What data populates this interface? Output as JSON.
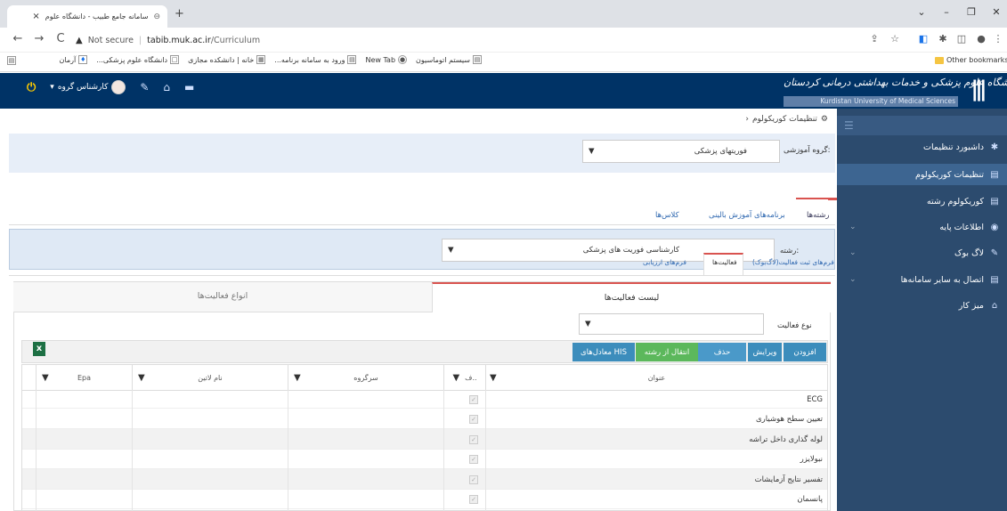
{
  "browser": {
    "tab_title": "سامانه جامع طبیب - دانشگاه علوم",
    "tab_close": "×",
    "new_tab": "+",
    "not_secure": "Not secure",
    "url_host": "tabib.muk.ac.ir",
    "url_path": "/Curriculum",
    "bookmarks": [
      {
        "label": "سیستم اتوماسیون"
      },
      {
        "label": "New Tab"
      },
      {
        "label": "ورود به سامانه برنامه..."
      },
      {
        "label": "خانه | دانشکده مجازی"
      },
      {
        "label": "دانشگاه علوم پزشکی..."
      },
      {
        "label": "آرمان"
      }
    ],
    "other_bookmarks": "Other bookmarks"
  },
  "header": {
    "uni_name_fa": "دانشگاه علوم پزشکی و خدمات بهداشتی درمانی کردستان",
    "uni_name_en": "Kurdistan University of Medical Sciences",
    "user_label": "کارشناس گروه"
  },
  "breadcrumb": {
    "label": "تنظیمات کوریکولوم"
  },
  "sidebar": {
    "items": [
      {
        "label": "داشبورد تنظیمات"
      },
      {
        "label": "تنظیمات کوریکولوم"
      },
      {
        "label": "کوریکولوم رشته"
      },
      {
        "label": "اطلاعات پایه"
      },
      {
        "label": "لاگ بوک"
      },
      {
        "label": "اتصال به سایر سامانه‌ها"
      },
      {
        "label": "میز کار"
      }
    ]
  },
  "group": {
    "label": "گروه آموزشی:",
    "value": "فوریتهای پزشکی"
  },
  "tabs_main": {
    "majors": "رشته‌ها",
    "clinical": "برنامه‌های آموزش بالینی",
    "classes": "کلاس‌ها"
  },
  "major": {
    "label": "رشته:",
    "value": "کارشناسی فوریت های پزشکی"
  },
  "tabs_sub": {
    "logbook_forms": "فرم‌های ثبت فعالیت(لاگ‌بوک)",
    "activities": "فعالیت‌ها",
    "eval_forms": "فرم‌های ارزیابی"
  },
  "panel": {
    "tab_list": "لیست فعالیت‌ها",
    "tab_types": "انواع فعالیت‌ها",
    "type_label": "نوع فعالیت",
    "buttons": {
      "add": "افزودن",
      "edit": "ویرایش",
      "delete": "حذف",
      "transfer": "انتقال از رشته",
      "his": "معادل‌های HIS"
    },
    "columns": {
      "title": "عنوان",
      "f": "ف..",
      "subgroup": "سرگروه",
      "latin": "نام لاتین",
      "epa": "Epa"
    },
    "rows": [
      {
        "title": "ECG"
      },
      {
        "title": "تعیین سطح هوشیاری"
      },
      {
        "title": "لوله گذاری داخل تراشه"
      },
      {
        "title": "نبولایزر"
      },
      {
        "title": "تفسیر نتایج آزمایشات"
      },
      {
        "title": "پانسمان"
      }
    ]
  },
  "colors": {
    "header_bg": "#003366",
    "sidebar_bg": "#2c4b6e",
    "accent_red": "#d9534f",
    "btn_blue": "#3c8dbc",
    "btn_green": "#5cb85c"
  }
}
